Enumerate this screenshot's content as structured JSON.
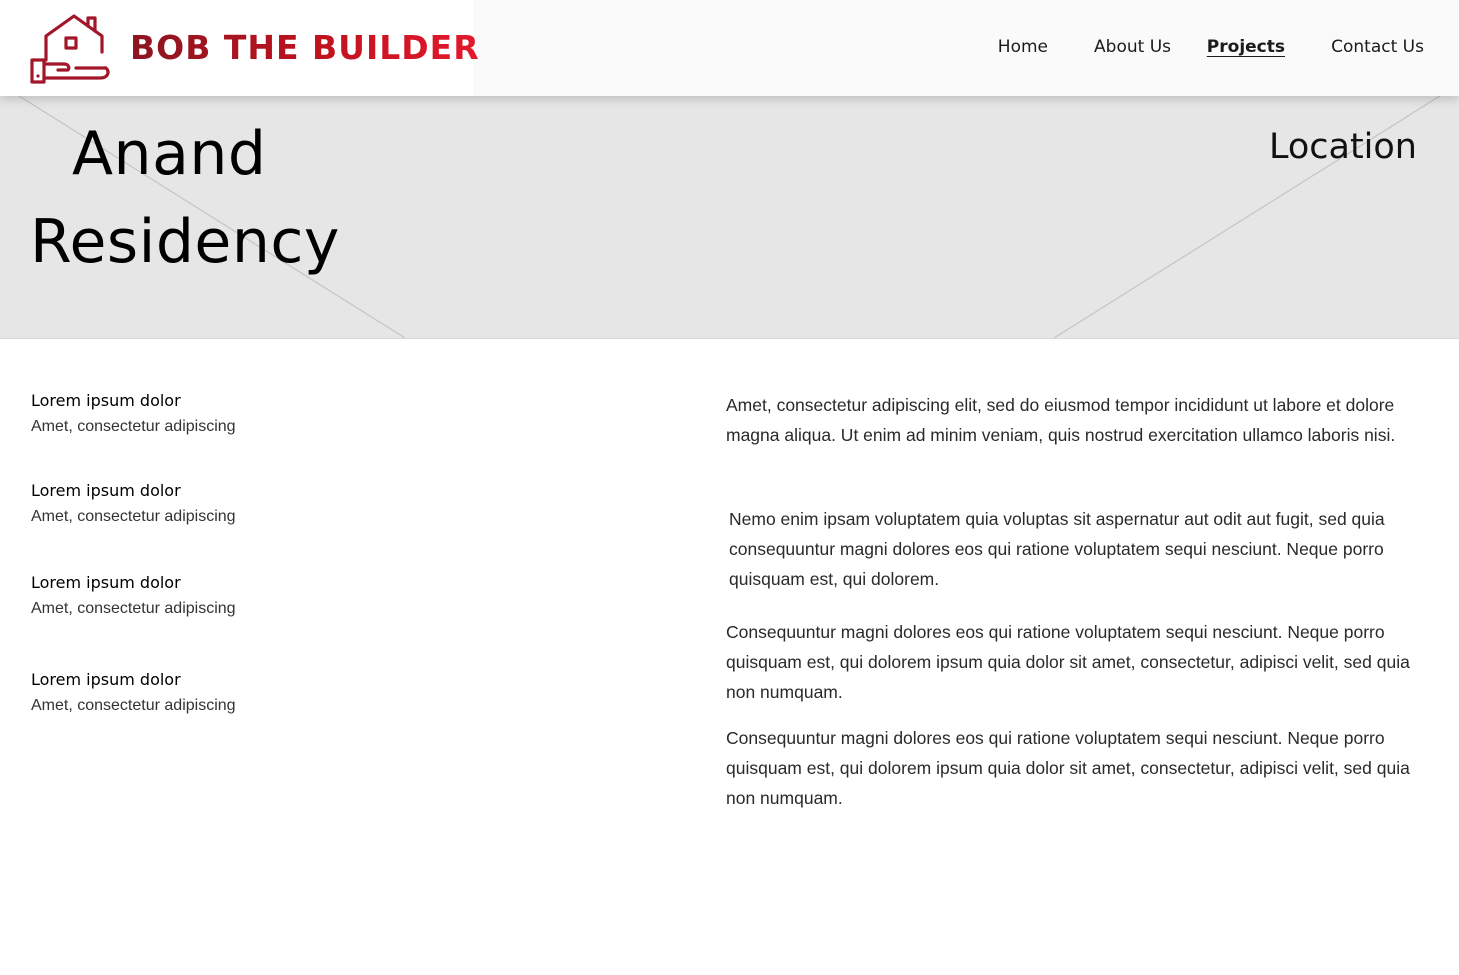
{
  "brand": {
    "name": "BOB THE BUILDER",
    "logo_icon": "house-in-hand-icon",
    "colors": {
      "dark": "#8b1520",
      "accent": "#e3192c"
    }
  },
  "nav": {
    "items": [
      {
        "label": "Home",
        "active": false
      },
      {
        "label": "About Us",
        "active": false
      },
      {
        "label": "Projects",
        "active": true
      },
      {
        "label": "Contact Us",
        "active": false
      }
    ]
  },
  "hero": {
    "title_line1": "Anand",
    "title_line2": "Residency",
    "location_label": "Location",
    "background_color": "#e6e6e6"
  },
  "specs": [
    {
      "title": "Lorem ipsum dolor",
      "subtitle": "Amet, consectetur adipiscing"
    },
    {
      "title": "Lorem ipsum dolor",
      "subtitle": "Amet, consectetur adipiscing"
    },
    {
      "title": "Lorem ipsum dolor",
      "subtitle": "Amet, consectetur adipiscing"
    },
    {
      "title": "Lorem ipsum dolor",
      "subtitle": "Amet, consectetur adipiscing"
    }
  ],
  "paragraphs": [
    "Amet, consectetur adipiscing elit, sed do eiusmod tempor incididunt ut labore et dolore magna aliqua. Ut enim ad minim veniam, quis nostrud exercitation ullamco laboris nisi.",
    "Nemo enim ipsam voluptatem quia voluptas sit aspernatur aut odit aut fugit, sed quia consequuntur magni dolores eos qui ratione voluptatem sequi nesciunt. Neque porro quisquam est, qui dolorem.",
    "Consequuntur magni dolores eos qui ratione voluptatem sequi nesciunt. Neque porro quisquam est, qui dolorem ipsum quia dolor sit amet, consectetur, adipisci velit, sed quia non numquam.",
    "Consequuntur magni dolores eos qui ratione voluptatem sequi nesciunt. Neque porro quisquam est, qui dolorem ipsum quia dolor sit amet, consectetur, adipisci velit, sed quia non numquam."
  ]
}
